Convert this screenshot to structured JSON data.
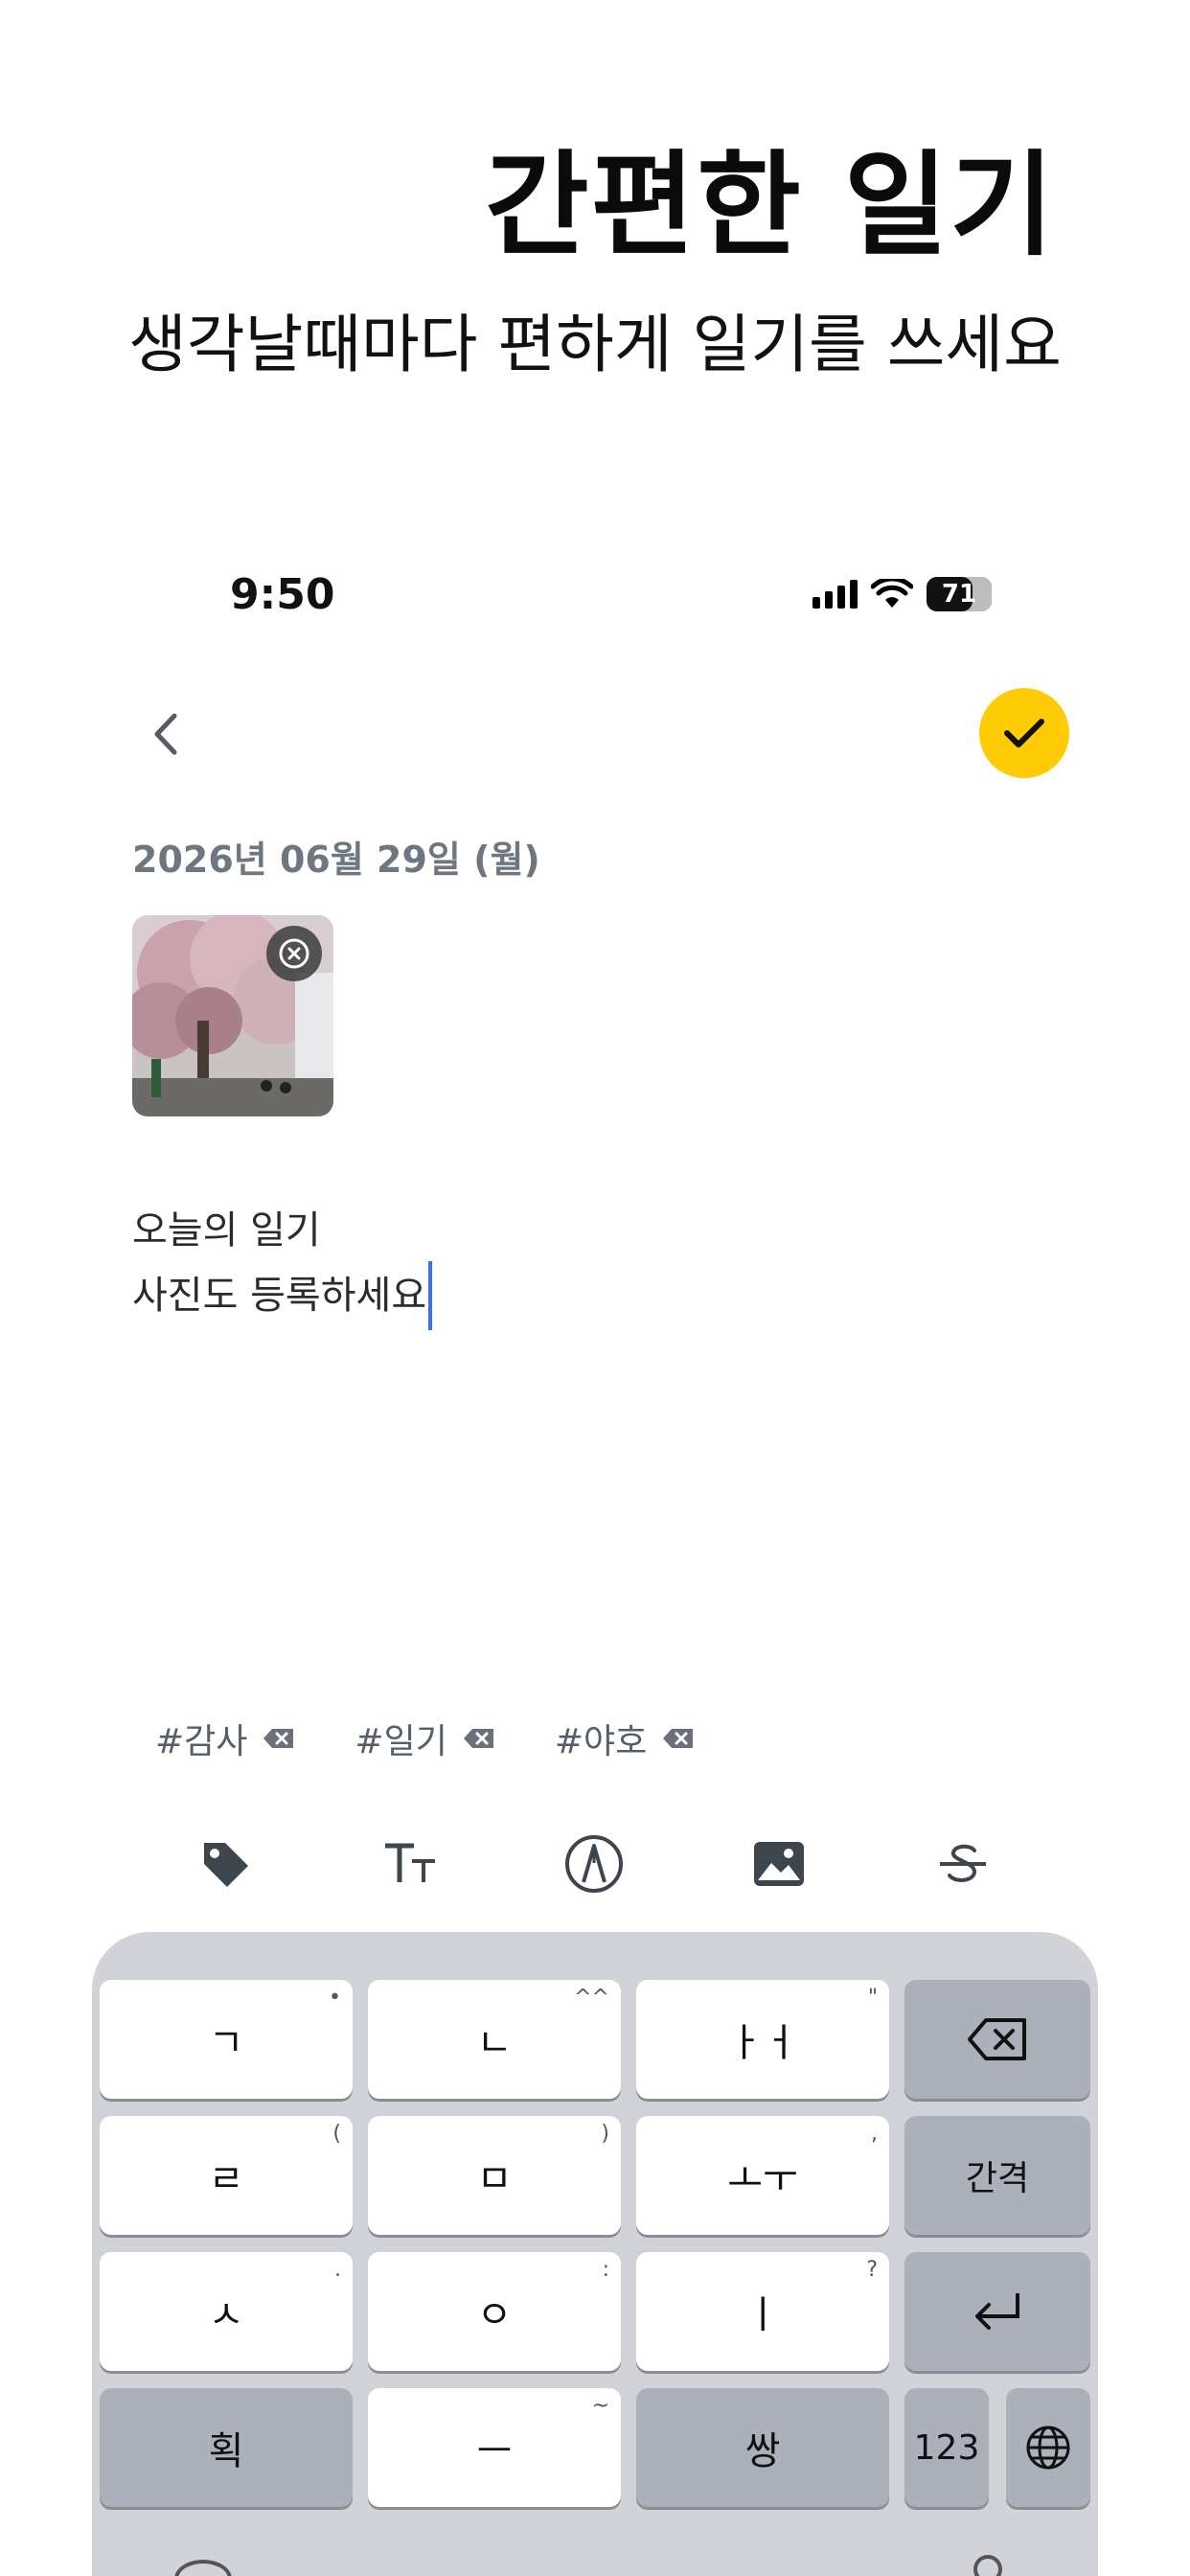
{
  "promo": {
    "title": "간편한 일기",
    "subtitle": "생각날때마다 편하게 일기를 쓰세요"
  },
  "status_bar": {
    "time": "9:50",
    "battery": "71",
    "battery_level": 0.71,
    "icons": [
      "cellular-signal-icon",
      "wifi-icon",
      "battery-icon"
    ]
  },
  "nav": {
    "back_icon": "chevron-left-icon",
    "done_icon": "check-icon",
    "done_color": "#FFCB05"
  },
  "entry": {
    "date": "2026년 06월 29일 (월)",
    "line1": "오늘의 일기",
    "line2": "사진도 등록하세요"
  },
  "tags": [
    {
      "label": "#감사"
    },
    {
      "label": "#일기"
    },
    {
      "label": "#야호"
    }
  ],
  "toolbar": {
    "icons": [
      "tag-icon",
      "text-size-icon",
      "pen-icon",
      "image-icon",
      "strikethrough-icon"
    ]
  },
  "keyboard": {
    "row1": [
      {
        "label": "ㄱ",
        "sub": "•"
      },
      {
        "label": "ㄴ",
        "sub": "^^"
      },
      {
        "label": "ㅏㅓ",
        "sub": "\""
      }
    ],
    "row2": [
      {
        "label": "ㄹ",
        "sub": "("
      },
      {
        "label": "ㅁ",
        "sub": ")"
      },
      {
        "label": "ㅗㅜ",
        "sub": ","
      },
      {
        "label": "간격"
      }
    ],
    "row3": [
      {
        "label": "ㅅ",
        "sub": "."
      },
      {
        "label": "ㅇ",
        "sub": ":"
      },
      {
        "label": "ㅣ",
        "sub": "?"
      }
    ],
    "row4": [
      {
        "label": "획"
      },
      {
        "label": "ㅡ",
        "sub": "~"
      },
      {
        "label": "쌍"
      },
      {
        "label": "123"
      }
    ],
    "accent_bg": "#abb0ba",
    "key_bg": "#ffffff"
  }
}
